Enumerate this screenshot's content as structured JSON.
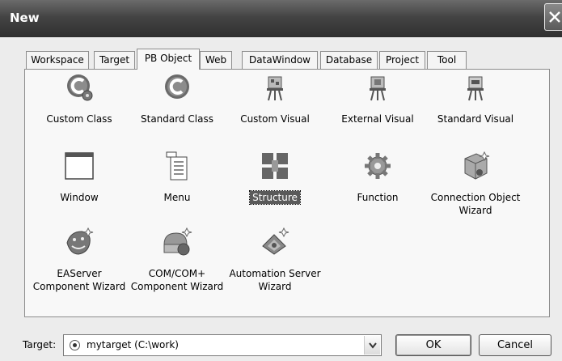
{
  "window": {
    "title": "New"
  },
  "tabs": [
    {
      "label": "Workspace"
    },
    {
      "label": "Target"
    },
    {
      "label": "PB Object"
    },
    {
      "label": "Web"
    },
    {
      "label": "DataWindow"
    },
    {
      "label": "Database"
    },
    {
      "label": "Project"
    },
    {
      "label": "Tool"
    }
  ],
  "active_tab": "PB Object",
  "items": [
    {
      "label": "Custom Class",
      "icon": "c-class-gear-icon"
    },
    {
      "label": "Standard Class",
      "icon": "c-class-icon"
    },
    {
      "label": "Custom Visual",
      "icon": "easel-icon"
    },
    {
      "label": "External Visual",
      "icon": "easel-icon"
    },
    {
      "label": "Standard Visual",
      "icon": "easel-icon"
    },
    {
      "label": "Window",
      "icon": "window-icon"
    },
    {
      "label": "Menu",
      "icon": "menu-icon"
    },
    {
      "label": "Structure",
      "icon": "structure-icon"
    },
    {
      "label": "Function",
      "icon": "gear-icon"
    },
    {
      "label": "Connection Object\nWizard",
      "icon": "cube-wizard-icon"
    },
    {
      "label": "EAServer\nComponent Wizard",
      "icon": "jaguar-icon"
    },
    {
      "label": "COM/COM+\nComponent Wizard",
      "icon": "com-wizard-icon"
    },
    {
      "label": "Automation Server\nWizard",
      "icon": "automation-wizard-icon"
    }
  ],
  "selected_item": "Structure",
  "footer": {
    "target_label": "Target:",
    "target_value": "mytarget (C:\\work)",
    "ok_label": "OK",
    "cancel_label": "Cancel"
  }
}
